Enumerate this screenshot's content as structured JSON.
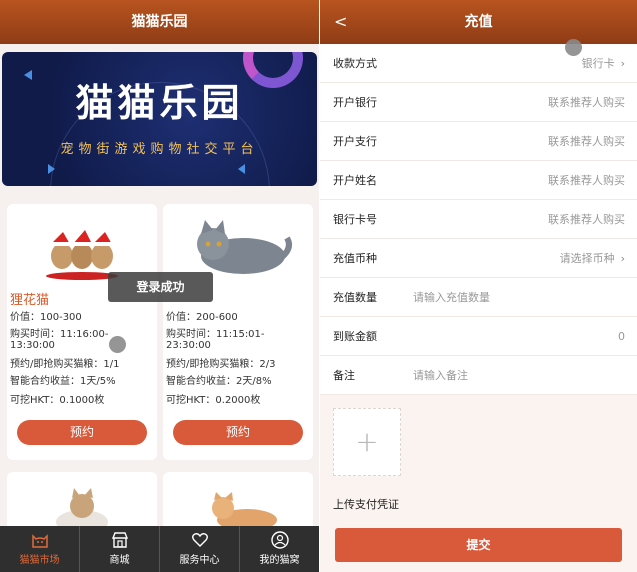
{
  "left": {
    "title": "猫猫乐园",
    "banner": {
      "title": "猫猫乐园",
      "subtitle": "宠物街游戏购物社交平台"
    },
    "cards": [
      {
        "name": "狸花猫",
        "price": "价值：100-300",
        "buy_time": "购买时间：11:16:00-",
        "buy_time2": "13:30:00",
        "reserve": "预约/即抢购买猫粮：1/1",
        "contract": "智能合约收益：1天/5%",
        "mine": "可挖HKT：0.1000枚",
        "button": "预约"
      },
      {
        "name": "",
        "price": "价值：200-600",
        "buy_time": "购买时间：11:15:01-",
        "buy_time2": "23:30:00",
        "reserve": "预约/即抢购买猫粮：2/3",
        "contract": "智能合约收益：2天/8%",
        "mine": "可挖HKT：0.2000枚",
        "button": "预约"
      }
    ],
    "toast": "登录成功",
    "tabs": [
      {
        "label": "猫猫市场",
        "icon": "cat-icon",
        "active": true
      },
      {
        "label": "商城",
        "icon": "store-icon",
        "active": false
      },
      {
        "label": "服务中心",
        "icon": "heart-hand-icon",
        "active": false
      },
      {
        "label": "我的猫窝",
        "icon": "user-icon",
        "active": false
      }
    ]
  },
  "right": {
    "title": "充值",
    "back": "<",
    "rows": [
      {
        "label": "收款方式",
        "value": "银行卡",
        "chevron": true
      },
      {
        "label": "开户银行",
        "value": "联系推荐人购买"
      },
      {
        "label": "开户支行",
        "value": "联系推荐人购买"
      },
      {
        "label": "开户姓名",
        "value": "联系推荐人购买"
      },
      {
        "label": "银行卡号",
        "value": "联系推荐人购买"
      },
      {
        "label": "充值币种",
        "value": "请选择币种",
        "chevron": true
      },
      {
        "label": "充值数量",
        "placeholder": "请输入充值数量"
      },
      {
        "label": "到账金额",
        "value": "0"
      },
      {
        "label": "备注",
        "placeholder": "请输入备注"
      }
    ],
    "upload_label": "上传支付凭证",
    "upload_plus": "+",
    "submit": "提交"
  },
  "colors": {
    "header": "#a4481b",
    "accent": "#d95a3a",
    "tab_bg": "#2f2f2f",
    "active_tab": "#e06a3a"
  }
}
